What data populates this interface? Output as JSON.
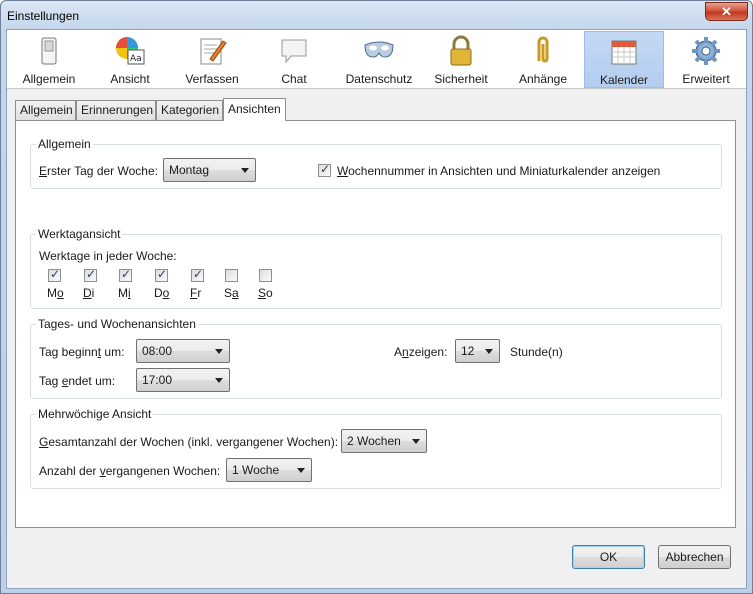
{
  "window": {
    "title": "Einstellungen",
    "close_glyph": "✕"
  },
  "toolbar": {
    "items": [
      {
        "label": "Allgemein",
        "icon": "switch-icon"
      },
      {
        "label": "Ansicht",
        "icon": "font-palette-icon"
      },
      {
        "label": "Verfassen",
        "icon": "compose-icon"
      },
      {
        "label": "Chat",
        "icon": "chat-bubble-icon"
      },
      {
        "label": "Datenschutz",
        "icon": "mask-icon"
      },
      {
        "label": "Sicherheit",
        "icon": "padlock-icon"
      },
      {
        "label": "Anhänge",
        "icon": "paperclip-icon"
      },
      {
        "label": "Kalender",
        "icon": "calendar-icon",
        "selected": true
      },
      {
        "label": "Erweitert",
        "icon": "gear-icon"
      }
    ]
  },
  "tabs": [
    {
      "label": "Allgemein"
    },
    {
      "label": "Erinnerungen"
    },
    {
      "label": "Kategorien"
    },
    {
      "label": "Ansichten",
      "active": true
    }
  ],
  "general": {
    "caption": "Allgemein",
    "first_day_label_pre": "E",
    "first_day_label_post": "rster Tag der Woche:",
    "first_day_value": "Montag",
    "week_number_pre": "W",
    "week_number_post": "ochennummer in Ansichten und Miniaturkalender anzeigen",
    "week_number_checked": true
  },
  "workweek": {
    "caption": "Werktagansicht",
    "label": "Werktage in jeder Woche:",
    "days": [
      {
        "pre": "M",
        "u": "o",
        "post": "",
        "checked": true
      },
      {
        "pre": "",
        "u": "D",
        "post": "i",
        "checked": true
      },
      {
        "pre": "M",
        "u": "i",
        "post": "",
        "checked": true
      },
      {
        "pre": "D",
        "u": "o",
        "post": "",
        "checked": true
      },
      {
        "pre": "",
        "u": "F",
        "post": "r",
        "checked": true
      },
      {
        "pre": "S",
        "u": "a",
        "post": "",
        "checked": false
      },
      {
        "pre": "",
        "u": "S",
        "post": "o",
        "checked": false
      }
    ]
  },
  "dayweek": {
    "caption": "Tages- und Wochenansichten",
    "start_pre": "Tag beginn",
    "start_u": "t",
    "start_post": " um:",
    "start_value": "08:00",
    "end_pre": "Tag ",
    "end_u": "e",
    "end_post": "ndet um:",
    "end_value": "17:00",
    "show_pre": "A",
    "show_u": "n",
    "show_post": "zeigen:",
    "show_value": "12",
    "hours_unit": "Stunde(n)"
  },
  "multiweek": {
    "caption": "Mehrwöchige Ansicht",
    "total_pre": "G",
    "total_post": "esamtanzahl der Wochen (inkl. vergangener Wochen):",
    "total_value": "2 Wochen",
    "past_pre": "Anzahl der ",
    "past_u": "v",
    "past_post": "ergangenen Wochen:",
    "past_value": "1 Woche"
  },
  "footer": {
    "ok_label": "OK",
    "cancel_label": "Abbrechen"
  }
}
